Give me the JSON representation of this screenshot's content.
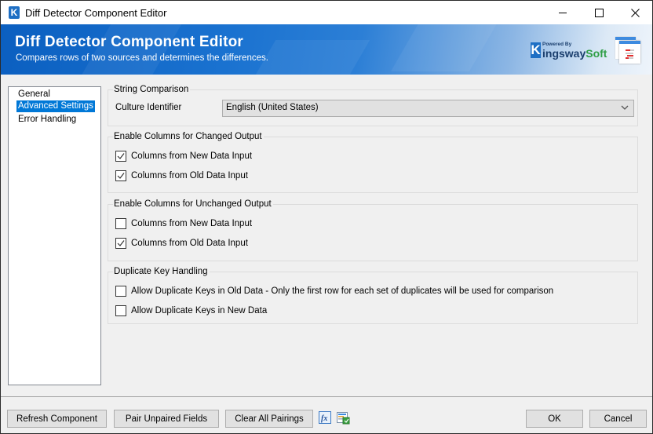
{
  "window": {
    "title": "Diff Detector Component Editor",
    "app_icon": "K",
    "controls": {
      "minimize": "minimize-icon",
      "maximize": "maximize-icon",
      "close": "close-icon"
    }
  },
  "banner": {
    "title": "Diff Detector Component Editor",
    "subtitle": "Compares rows of two sources and determines the differences.",
    "brand": {
      "powered_by": "Powered By",
      "k": "K",
      "name_part1": "ingsway",
      "name_part2": "Soft"
    },
    "colors": {
      "banner_blue": "#1a72d0",
      "brand_green": "#2e9e45",
      "brand_navy": "#1b3f6e"
    }
  },
  "nav": {
    "items": [
      {
        "label": "General",
        "selected": false
      },
      {
        "label": "Advanced Settings",
        "selected": true
      },
      {
        "label": "Error Handling",
        "selected": false
      }
    ],
    "selection_color": "#0078d7"
  },
  "string_comparison": {
    "legend": "String Comparison",
    "culture_label": "Culture Identifier",
    "culture_value": "English (United States)"
  },
  "changed_output": {
    "legend": "Enable Columns for Changed Output",
    "options": [
      {
        "label": "Columns from New Data Input",
        "checked": true
      },
      {
        "label": "Columns from Old Data Input",
        "checked": true
      }
    ]
  },
  "unchanged_output": {
    "legend": "Enable Columns for Unchanged Output",
    "options": [
      {
        "label": "Columns from New Data Input",
        "checked": false
      },
      {
        "label": "Columns from Old Data Input",
        "checked": true
      }
    ]
  },
  "duplicate_keys": {
    "legend": "Duplicate Key Handling",
    "options": [
      {
        "label": "Allow Duplicate Keys in Old Data - Only the first row for each set of duplicates will be used for comparison",
        "checked": false
      },
      {
        "label": "Allow Duplicate Keys in New Data",
        "checked": false
      }
    ]
  },
  "footer": {
    "refresh": "Refresh Component",
    "pair": "Pair Unpaired Fields",
    "clear": "Clear All Pairings",
    "ok": "OK",
    "cancel": "Cancel",
    "icons": [
      "fx-expression-icon",
      "table-mapping-icon"
    ]
  }
}
